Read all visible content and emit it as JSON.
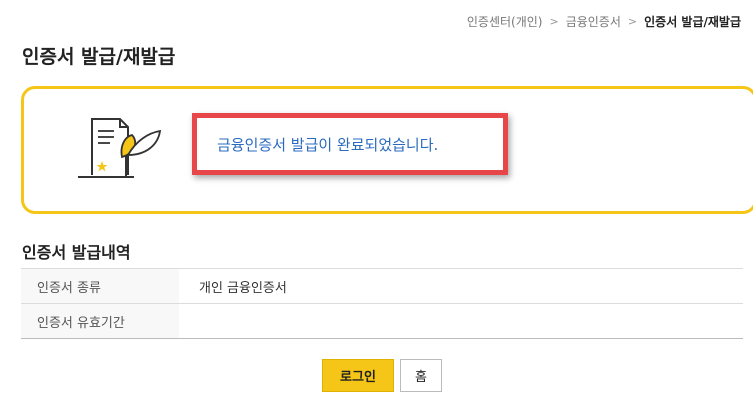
{
  "breadcrumb": {
    "items": [
      "인증센터(개인)",
      "금융인증서",
      "인증서 발급/재발급"
    ],
    "separator": ">"
  },
  "page": {
    "title": "인증서 발급/재발급"
  },
  "result": {
    "message": "금융인증서 발급이 완료되었습니다.",
    "illustration_icon": "certificate-leaf-icon",
    "colors": {
      "border": "#f5c518",
      "message": "#2a6bbf",
      "highlight": "#e8474a"
    }
  },
  "history": {
    "title": "인증서 발급내역",
    "rows": [
      {
        "label": "인증서 종류",
        "value": "개인 금융인증서"
      },
      {
        "label": "인증서 유효기간",
        "value": ""
      }
    ]
  },
  "buttons": {
    "login_label": "로그인",
    "home_label": "홈"
  }
}
